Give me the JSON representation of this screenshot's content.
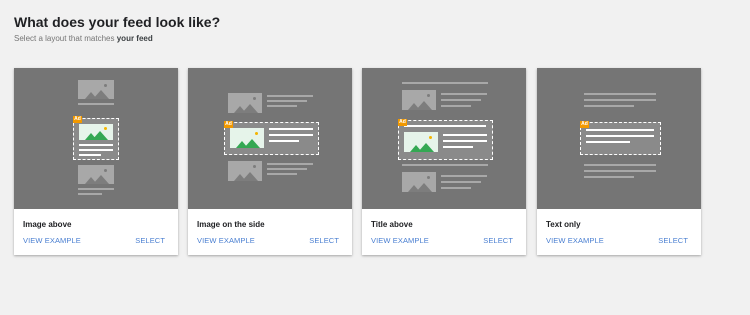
{
  "header": {
    "title": "What does your feed look like?",
    "subtitle_prefix": "Select a layout that matches ",
    "subtitle_emphasis": "your feed"
  },
  "cards": [
    {
      "title": "Image above",
      "view_label": "VIEW EXAMPLE",
      "select_label": "SELECT",
      "ad_badge": "Ad"
    },
    {
      "title": "Image on the side",
      "view_label": "VIEW EXAMPLE",
      "select_label": "SELECT",
      "ad_badge": "Ad"
    },
    {
      "title": "Title above",
      "view_label": "VIEW EXAMPLE",
      "select_label": "SELECT",
      "ad_badge": "Ad"
    },
    {
      "title": "Text only",
      "view_label": "VIEW EXAMPLE",
      "select_label": "SELECT",
      "ad_badge": "Ad"
    }
  ],
  "colors": {
    "preview_bg": "#757575",
    "link": "#4a7fd1",
    "ad_badge": "#f29900",
    "ad_image_mountain": "#34a853",
    "ad_image_sun": "#f5b400"
  }
}
